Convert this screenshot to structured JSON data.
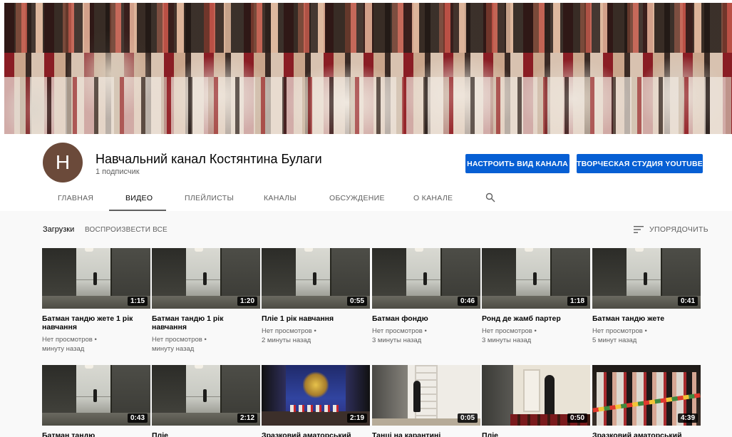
{
  "channel": {
    "avatar_letter": "Н",
    "name": "Навчальний канал Костянтина Булаги",
    "subscribers": "1 подписчик",
    "avatar_color": "#6b4a3a"
  },
  "buttons": {
    "customize": "НАСТРОИТЬ ВИД КАНАЛА",
    "studio": "ТВОРЧЕСКАЯ СТУДИЯ YOUTUBE",
    "color": "#065fd4"
  },
  "tabs": [
    {
      "label": "ГЛАВНАЯ",
      "active": false
    },
    {
      "label": "ВИДЕО",
      "active": true
    },
    {
      "label": "ПЛЕЙЛИСТЫ",
      "active": false
    },
    {
      "label": "КАНАЛЫ",
      "active": false
    },
    {
      "label": "ОБСУЖДЕНИЕ",
      "active": false
    },
    {
      "label": "О КАНАЛЕ",
      "active": false
    }
  ],
  "search_icon": "search-icon",
  "uploads": {
    "label": "Загрузки",
    "play_all": "ВОСПРОИЗВЕСТИ ВСЕ",
    "sort_label": "УПОРЯДОЧИТЬ",
    "sort_icon": "sort-icon"
  },
  "videos_row1": [
    {
      "title": "Батман тандю жете 1 рік навчання",
      "duration": "1:15",
      "views": "Нет просмотров •",
      "time": "минуту назад"
    },
    {
      "title": "Батман тандю 1 рік навчання",
      "duration": "1:20",
      "views": "Нет просмотров •",
      "time": "минуту назад"
    },
    {
      "title": "Пліе 1 рік навчання",
      "duration": "0:55",
      "views": "Нет просмотров •",
      "time": "2 минуты назад"
    },
    {
      "title": "Батман фондю",
      "duration": "0:46",
      "views": "Нет просмотров •",
      "time": "3 минуты назад"
    },
    {
      "title": "Ронд де жамб партер",
      "duration": "1:18",
      "views": "Нет просмотров •",
      "time": "3 минуты назад"
    },
    {
      "title": "Батман тандю жете",
      "duration": "0:41",
      "views": "Нет просмотров •",
      "time": "5 минут назад"
    }
  ],
  "videos_row2": [
    {
      "title": "Батман тандю",
      "duration": "0:43"
    },
    {
      "title": "Пліе",
      "duration": "2:12"
    },
    {
      "title": "Зразковий аматорський",
      "duration": "2:19"
    },
    {
      "title": "Танці на карантині",
      "duration": "0:05"
    },
    {
      "title": "Пліе",
      "duration": "0:50"
    },
    {
      "title": "Зразковий аматорський",
      "duration": "4:39"
    }
  ]
}
